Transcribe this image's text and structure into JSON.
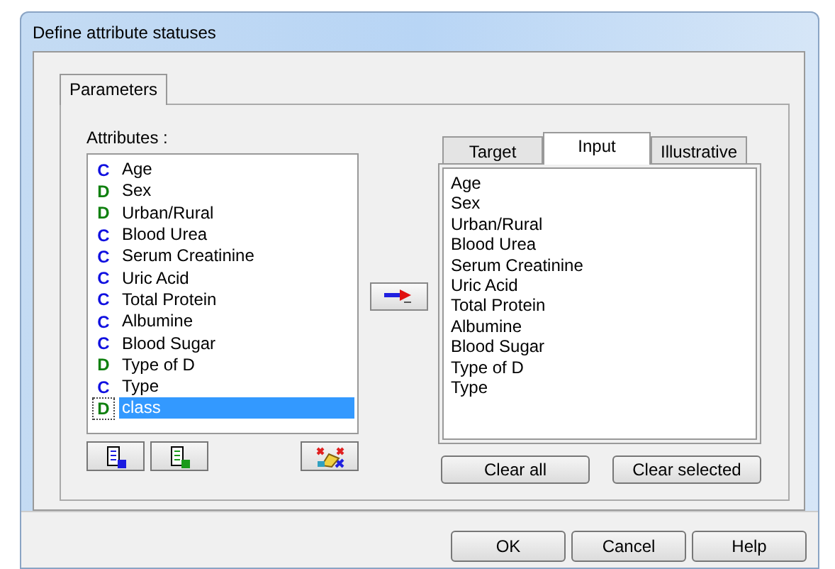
{
  "window": {
    "title": "Define attribute statuses"
  },
  "tabs": [
    {
      "label": "Parameters",
      "selected": true
    }
  ],
  "attributes": {
    "label": "Attributes :",
    "items": [
      {
        "badge": "C",
        "kind": "continuous",
        "label": "Age",
        "selected": false
      },
      {
        "badge": "D",
        "kind": "discrete",
        "label": "Sex",
        "selected": false
      },
      {
        "badge": "D",
        "kind": "discrete",
        "label": "Urban/Rural",
        "selected": false
      },
      {
        "badge": "C",
        "kind": "continuous",
        "label": "Blood Urea",
        "selected": false
      },
      {
        "badge": "C",
        "kind": "continuous",
        "label": "Serum Creatinine",
        "selected": false
      },
      {
        "badge": "C",
        "kind": "continuous",
        "label": "Uric Acid",
        "selected": false
      },
      {
        "badge": "C",
        "kind": "continuous",
        "label": "Total Protein",
        "selected": false
      },
      {
        "badge": "C",
        "kind": "continuous",
        "label": "Albumine",
        "selected": false
      },
      {
        "badge": "C",
        "kind": "continuous",
        "label": "Blood Sugar",
        "selected": false
      },
      {
        "badge": "D",
        "kind": "discrete",
        "label": "Type of D",
        "selected": false
      },
      {
        "badge": "C",
        "kind": "continuous",
        "label": "Type",
        "selected": false
      },
      {
        "badge": "D",
        "kind": "discrete",
        "label": "class",
        "selected": true
      }
    ]
  },
  "status_tabs": [
    {
      "label": "Target",
      "selected": false
    },
    {
      "label": "Input",
      "selected": true
    },
    {
      "label": "Illustrative",
      "selected": false
    }
  ],
  "status_list": [
    "Age",
    "Sex",
    "Urban/Rural",
    "Blood Urea",
    "Serum Creatinine",
    "Uric Acid",
    "Total Protein",
    "Albumine",
    "Blood Sugar",
    "Type of D",
    "Type"
  ],
  "list_buttons": [
    "Clear all",
    "Clear selected"
  ],
  "buttons": [
    "OK",
    "Cancel",
    "Help"
  ]
}
